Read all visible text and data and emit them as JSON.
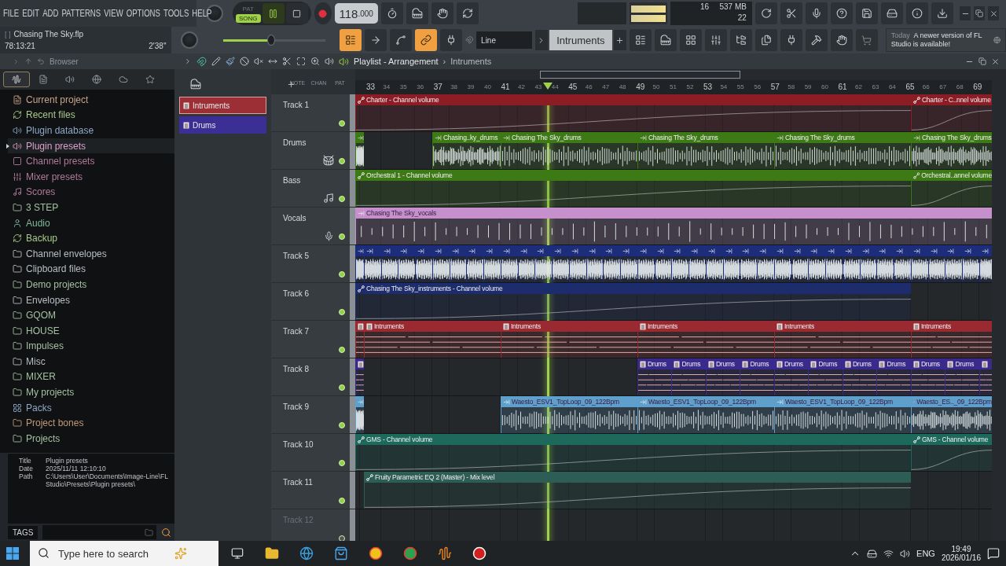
{
  "menu": [
    "FILE",
    "EDIT",
    "ADD",
    "PATTERNS",
    "VIEW",
    "OPTIONS",
    "TOOLS",
    "HELP"
  ],
  "transport": {
    "modes": [
      {
        "label": "PAT",
        "selected": false
      },
      {
        "label": "SONG",
        "selected": true
      }
    ],
    "playing": true,
    "tempo": "118",
    "tempo_fraction": ".000"
  },
  "monitor": {
    "polyphony": "16",
    "memory": "537 MB",
    "cpu": "22"
  },
  "song": {
    "marker": "[   ]",
    "file": "Chasing The Sky.flp",
    "time": "78:13:21",
    "length": "2'38''"
  },
  "master_volume": {
    "level": 0.47
  },
  "snap_tools": [
    {
      "on": true
    },
    {
      "on": false
    },
    {
      "on": false
    },
    {
      "on": true
    },
    {
      "on": false
    }
  ],
  "snap": "Line",
  "pattern": "Intruments",
  "news": {
    "day": "Today",
    "message": "A newer version of FL Studio is available!"
  },
  "browser": {
    "title": "Browser",
    "tabs": [
      {
        "selected": true
      },
      {
        "selected": false
      },
      {
        "selected": false
      },
      {
        "selected": false
      },
      {
        "selected": false
      },
      {
        "selected": false
      }
    ],
    "items": [
      {
        "label": "Current project",
        "kind": "project",
        "selected": false
      },
      {
        "label": "Recent files",
        "kind": "recent",
        "selected": false
      },
      {
        "label": "Plugin database",
        "kind": "plugin-db",
        "selected": false
      },
      {
        "label": "Plugin presets",
        "kind": "plugin-presets",
        "selected": true
      },
      {
        "label": "Channel presets",
        "kind": "channel-presets",
        "selected": false
      },
      {
        "label": "Mixer presets",
        "kind": "mixer-presets",
        "selected": false
      },
      {
        "label": "Scores",
        "kind": "scores",
        "selected": false
      },
      {
        "label": "3 STEP",
        "kind": "folder",
        "selected": false
      },
      {
        "label": "Audio",
        "kind": "audio",
        "selected": false
      },
      {
        "label": "Backup",
        "kind": "recent",
        "selected": false
      },
      {
        "label": "Channel envelopes",
        "kind": "plain",
        "selected": false
      },
      {
        "label": "Clipboard files",
        "kind": "plain",
        "selected": false
      },
      {
        "label": "Demo projects",
        "kind": "folder",
        "selected": false
      },
      {
        "label": "Envelopes",
        "kind": "plain",
        "selected": false
      },
      {
        "label": "GQOM",
        "kind": "folder",
        "selected": false
      },
      {
        "label": "HOUSE",
        "kind": "folder",
        "selected": false
      },
      {
        "label": "Impulses",
        "kind": "folder",
        "selected": false
      },
      {
        "label": "Misc",
        "kind": "plain",
        "selected": false
      },
      {
        "label": "MIXER",
        "kind": "folder",
        "selected": false
      },
      {
        "label": "My projects",
        "kind": "folder",
        "selected": false
      },
      {
        "label": "Packs",
        "kind": "packs",
        "selected": false
      },
      {
        "label": "Project bones",
        "kind": "bones",
        "selected": false
      },
      {
        "label": "Projects",
        "kind": "folder",
        "selected": false
      }
    ],
    "info": [
      {
        "key": "Title",
        "value": "Plugin presets"
      },
      {
        "key": "Date",
        "value": "2025/11/11 12:10:10"
      },
      {
        "key": "Path",
        "value": "C:\\Users\\User\\Documents\\Image-Line\\FL Studio\\Presets\\Plugin presets\\"
      }
    ],
    "tags": "TAGS"
  },
  "playlist": {
    "title": "Playlist - Arrangement",
    "separator": "›",
    "pattern": "Intruments",
    "picker_labels": [
      "NOTE",
      "CHAN",
      "PAT"
    ],
    "patterns": [
      {
        "name": "Intruments",
        "color": "#9c2f36",
        "selected": true
      },
      {
        "name": "Drums",
        "color": "#3b2f96",
        "selected": false
      }
    ],
    "ruler": [
      "33",
      "34",
      "35",
      "36",
      "37",
      "38",
      "39",
      "40",
      "41",
      "42",
      "43",
      "44",
      "45",
      "46",
      "47",
      "48",
      "49",
      "50",
      "51",
      "52",
      "53",
      "54",
      "55",
      "56",
      "57",
      "58",
      "59",
      "60",
      "61",
      "62",
      "63",
      "64",
      "65",
      "66",
      "67",
      "68",
      "69"
    ],
    "tracks": [
      {
        "name": "Track 1",
        "kind": "none",
        "color": "#8c1d25",
        "on": true,
        "clips": [
          {
            "kind": "automation",
            "name": "Charter - Channel volume"
          },
          {
            "kind": "automation",
            "name": "Charter - C..nnel volume"
          }
        ]
      },
      {
        "name": "Drums",
        "kind": "drum",
        "color": "#3d7a16",
        "on": true,
        "clips": [
          {
            "kind": "audio"
          },
          {
            "kind": "audio",
            "name": "Chasing..ky_drums"
          },
          {
            "kind": "audio",
            "name": "Chasing The Sky_drums"
          },
          {
            "kind": "audio",
            "name": "Chasing The Sky_drums"
          },
          {
            "kind": "audio",
            "name": "Chasing The Sky_drums"
          },
          {
            "kind": "audio",
            "name": "Chasing The Sky_drums"
          }
        ]
      },
      {
        "name": "Bass",
        "kind": "bass",
        "color": "#3d7a16",
        "on": true,
        "clips": [
          {
            "kind": "automation",
            "name": "Orchestral 1 - Channel volume"
          },
          {
            "kind": "automation",
            "name": "Orchestral..annel volume"
          }
        ]
      },
      {
        "name": "Vocals",
        "kind": "vocal",
        "color": "#c690cc",
        "on": true,
        "clips": [
          {
            "kind": "audio",
            "name": "Chasing The Sky_vocals"
          }
        ]
      },
      {
        "name": "Track 5",
        "kind": "none",
        "color": "#1c2d7c",
        "on": true,
        "clips": [
          {
            "kind": "audio"
          },
          {
            "kind": "audio"
          },
          {
            "kind": "audio"
          },
          {
            "kind": "audio"
          },
          {
            "kind": "audio"
          },
          {
            "kind": "audio"
          },
          {
            "kind": "audio"
          },
          {
            "kind": "audio"
          },
          {
            "kind": "audio"
          },
          {
            "kind": "audio"
          },
          {
            "kind": "audio"
          },
          {
            "kind": "audio"
          },
          {
            "kind": "audio"
          },
          {
            "kind": "audio"
          },
          {
            "kind": "audio"
          },
          {
            "kind": "audio"
          },
          {
            "kind": "audio"
          },
          {
            "kind": "audio"
          },
          {
            "kind": "audio"
          },
          {
            "kind": "audio"
          },
          {
            "kind": "audio"
          },
          {
            "kind": "audio"
          },
          {
            "kind": "audio"
          },
          {
            "kind": "audio"
          },
          {
            "kind": "audio"
          },
          {
            "kind": "audio"
          },
          {
            "kind": "audio"
          },
          {
            "kind": "audio"
          },
          {
            "kind": "audio"
          },
          {
            "kind": "audio"
          },
          {
            "kind": "audio"
          },
          {
            "kind": "audio"
          },
          {
            "kind": "audio"
          },
          {
            "kind": "audio"
          },
          {
            "kind": "audio"
          },
          {
            "kind": "audio"
          },
          {
            "kind": "audio"
          },
          {
            "kind": "audio"
          }
        ]
      },
      {
        "name": "Track 6",
        "kind": "none",
        "color": "#1d2c6c",
        "on": true,
        "clips": [
          {
            "kind": "automation",
            "name": "Chasing The Sky_instruments - Channel volume"
          }
        ]
      },
      {
        "name": "Track 7",
        "kind": "none",
        "color": "#9a2a31",
        "on": true,
        "clips": [
          {
            "kind": "pattern"
          },
          {
            "kind": "pattern",
            "name": "Intruments"
          },
          {
            "kind": "pattern",
            "name": "Intruments"
          },
          {
            "kind": "pattern",
            "name": "Intruments"
          },
          {
            "kind": "pattern",
            "name": "Intruments"
          },
          {
            "kind": "pattern",
            "name": "Intruments"
          }
        ]
      },
      {
        "name": "Track 8",
        "kind": "none",
        "color": "#3a2a8c",
        "on": true,
        "clips": [
          {
            "kind": "pattern"
          },
          {
            "kind": "pattern",
            "name": "Drums"
          },
          {
            "kind": "pattern",
            "name": "Drums"
          },
          {
            "kind": "pattern",
            "name": "Drums"
          },
          {
            "kind": "pattern",
            "name": "Drums"
          },
          {
            "kind": "pattern",
            "name": "Drums"
          },
          {
            "kind": "pattern",
            "name": "Drums"
          },
          {
            "kind": "pattern",
            "name": "Drums"
          },
          {
            "kind": "pattern",
            "name": "Drums"
          },
          {
            "kind": "pattern",
            "name": "Drums"
          },
          {
            "kind": "pattern",
            "name": "Drums"
          },
          {
            "kind": "pattern"
          }
        ]
      },
      {
        "name": "Track 9",
        "kind": "none",
        "color": "#5f9fcc",
        "on": true,
        "clips": [
          {
            "kind": "audio"
          },
          {
            "kind": "audio",
            "name": "Waesto_ESV1_TopLoop_09_122Bpm"
          },
          {
            "kind": "audio",
            "name": "Waesto_ESV1_TopLoop_09_122Bpm"
          },
          {
            "kind": "audio",
            "name": "Waesto_ESV1_TopLoop_09_122Bpm"
          },
          {
            "kind": "audio",
            "name": "Waesto_ES.._09_122Bpm"
          }
        ]
      },
      {
        "name": "Track 10",
        "kind": "none",
        "color": "#1d6a5c",
        "on": true,
        "clips": [
          {
            "kind": "automation",
            "name": "GMS - Channel volume"
          },
          {
            "kind": "automation",
            "name": "GMS - Channel volume"
          }
        ]
      },
      {
        "name": "Track 11",
        "kind": "none",
        "color": "#2d5d54",
        "on": true,
        "clips": [
          {
            "kind": "automation",
            "name": "Fruity Parametric EQ 2 (Master) - Mix level"
          }
        ]
      },
      {
        "name": "Track 12",
        "kind": "none",
        "on": false
      }
    ]
  },
  "taskbar": {
    "search": {
      "placeholder": "Type here to search"
    },
    "language": "ENG",
    "time": "19:49",
    "date": "2026/01/16"
  }
}
